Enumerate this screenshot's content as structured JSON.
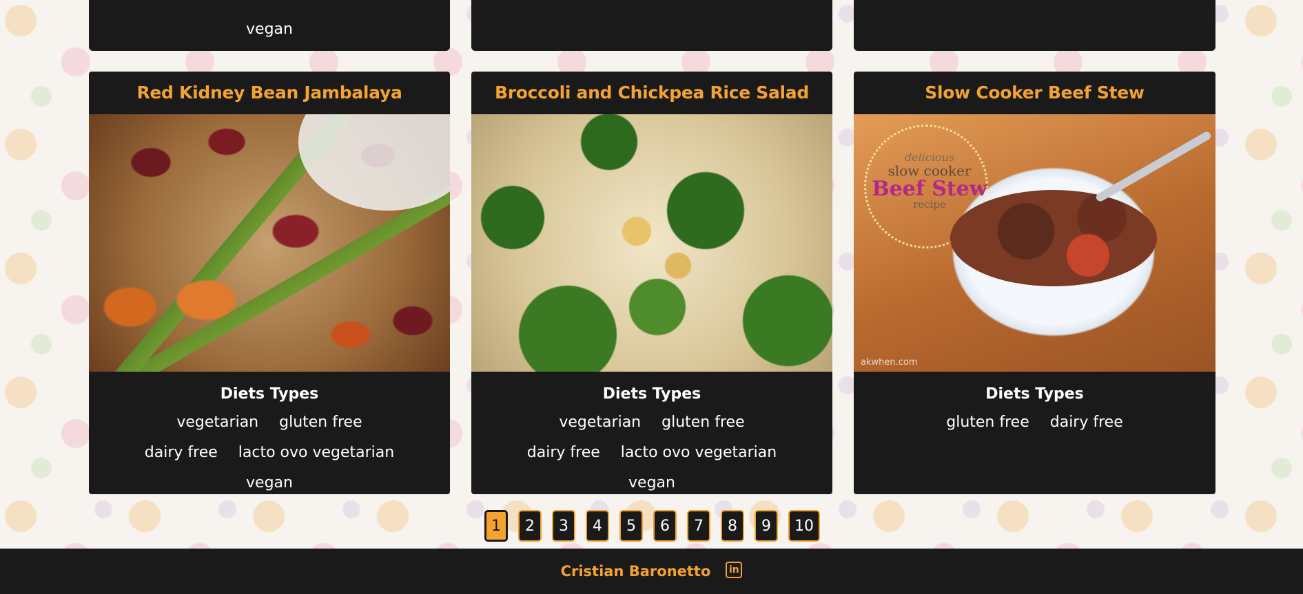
{
  "top_cards": [
    {
      "tags": [
        "vegan"
      ]
    },
    {
      "tags": []
    },
    {
      "tags": []
    }
  ],
  "recipes": [
    {
      "title": "Red Kidney Bean Jambalaya",
      "diets_heading": "Diets Types",
      "tags": [
        "vegetarian",
        "gluten free",
        "dairy free",
        "lacto ovo vegetarian",
        "vegan"
      ]
    },
    {
      "title": "Broccoli and Chickpea Rice Salad",
      "diets_heading": "Diets Types",
      "tags": [
        "vegetarian",
        "gluten free",
        "dairy free",
        "lacto ovo vegetarian",
        "vegan"
      ]
    },
    {
      "title": "Slow Cooker Beef Stew",
      "diets_heading": "Diets Types",
      "tags": [
        "gluten free",
        "dairy free"
      ],
      "image_text": [
        "delicious",
        "slow cooker",
        "Beef Stew",
        "recipe"
      ],
      "image_watermark": "akwhen.com"
    }
  ],
  "pagination": {
    "pages": [
      "1",
      "2",
      "3",
      "4",
      "5",
      "6",
      "7",
      "8",
      "9",
      "10"
    ],
    "active": "1"
  },
  "footer": {
    "author": "Cristian Baronetto",
    "linkedin_icon": "linkedin-icon",
    "linkedin_label": "in"
  },
  "colors": {
    "accent": "#f4a230",
    "card_bg": "#1a1a1a",
    "text": "#ffffff"
  }
}
